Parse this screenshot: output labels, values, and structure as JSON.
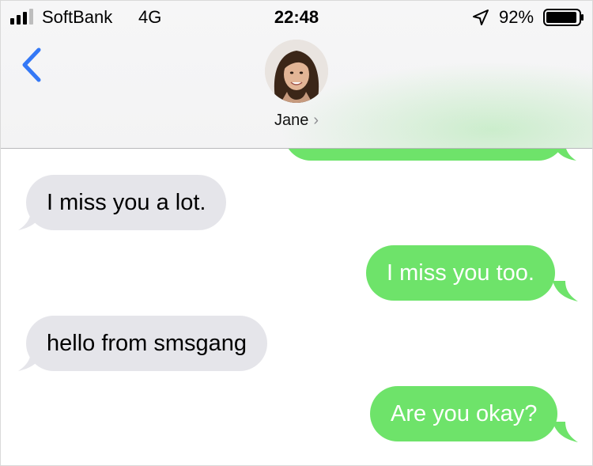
{
  "status_bar": {
    "carrier": "SoftBank",
    "network": "4G",
    "time": "22:48",
    "battery_percent": "92%"
  },
  "header": {
    "contact_name": "Jane",
    "back_icon": "chevron-left-icon",
    "disclosure_icon": "chevron-right-icon"
  },
  "messages": [
    {
      "direction": "incoming",
      "text": "I miss you a lot."
    },
    {
      "direction": "outgoing",
      "text": "I miss you too."
    },
    {
      "direction": "incoming",
      "text": "hello from smsgang"
    },
    {
      "direction": "outgoing",
      "text": "Are you okay?"
    }
  ],
  "colors": {
    "incoming_bubble": "#e5e5ea",
    "outgoing_bubble": "#6ee36a",
    "accent": "#3478f6"
  }
}
